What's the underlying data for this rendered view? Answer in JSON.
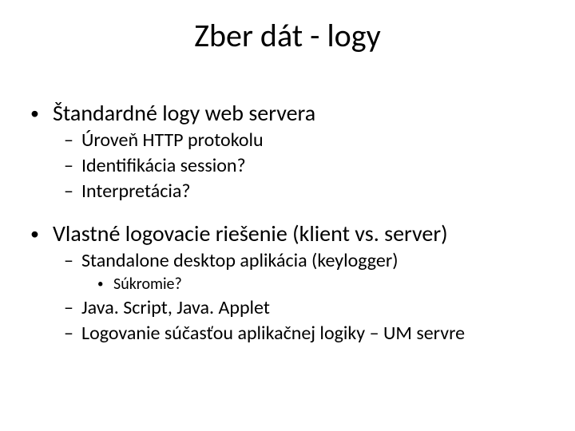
{
  "slide": {
    "title": "Zber dát - logy",
    "items": [
      {
        "level": 1,
        "text": "Štandardné logy web servera"
      },
      {
        "level": 2,
        "text": "Úroveň HTTP protokolu"
      },
      {
        "level": 2,
        "text": "Identifikácia session?"
      },
      {
        "level": 2,
        "text": "Interpretácia?"
      },
      {
        "level": 0,
        "text": ""
      },
      {
        "level": 1,
        "text": "Vlastné logovacie riešenie (klient vs. server)"
      },
      {
        "level": 2,
        "text": "Standalone desktop aplikácia (keylogger)"
      },
      {
        "level": 3,
        "text": "Súkromie?"
      },
      {
        "level": 2,
        "text": "Java. Script, Java. Applet"
      },
      {
        "level": 2,
        "text": "Logovanie súčasťou aplikačnej logiky – UM servre"
      }
    ],
    "bullets": {
      "lvl1": "•",
      "lvl2": "–",
      "lvl3": "•"
    }
  }
}
